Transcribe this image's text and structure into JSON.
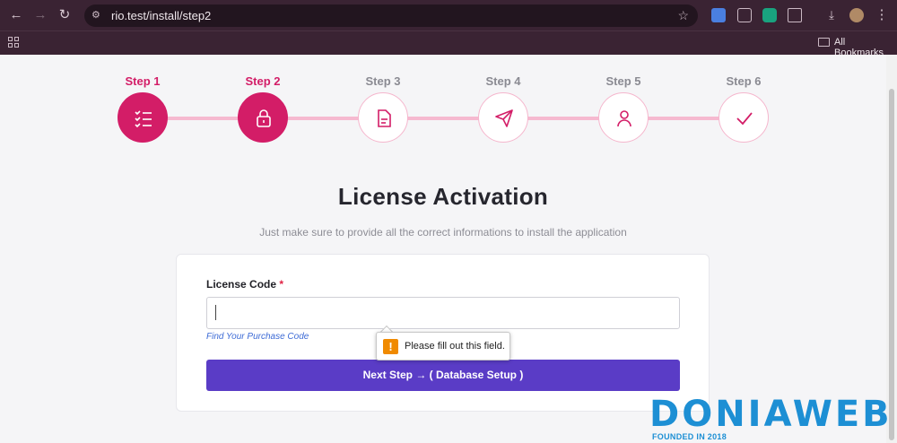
{
  "browser": {
    "url": "rio.test/install/step2",
    "bookmarks_label": "All Bookmarks",
    "icons": [
      "back-icon",
      "forward-icon",
      "reload-icon",
      "site-settings-icon",
      "bookmark-star-icon",
      "translate-icon",
      "extension-icon",
      "chatgpt-icon",
      "puzzle-icon",
      "download-icon",
      "profile-avatar",
      "menu-icon",
      "apps-icon",
      "folder-icon"
    ]
  },
  "steps": [
    {
      "label": "Step 1",
      "icon": "checklist-icon",
      "state": "completed"
    },
    {
      "label": "Step 2",
      "icon": "lock-icon",
      "state": "current"
    },
    {
      "label": "Step 3",
      "icon": "document-icon",
      "state": "pending"
    },
    {
      "label": "Step 4",
      "icon": "paper-plane-icon",
      "state": "pending"
    },
    {
      "label": "Step 5",
      "icon": "user-icon",
      "state": "pending"
    },
    {
      "label": "Step 6",
      "icon": "check-icon",
      "state": "pending"
    }
  ],
  "main": {
    "title": "License Activation",
    "subtitle": "Just make sure to provide all the correct informations to install the application"
  },
  "form": {
    "license_label": "License Code",
    "required_mark": "*",
    "license_value": "",
    "purchase_link": "Find Your Purchase Code",
    "next_button": "Next Step → ( Database Setup )"
  },
  "validation": {
    "message": "Please fill out this field."
  },
  "watermark": {
    "brand": "DONIAWEB",
    "tagline": "FOUNDED IN 2018"
  },
  "colors": {
    "accent": "#d31d67",
    "button": "#5a3cc6",
    "connector": "#f6b9d0",
    "chrome": "#3a2333",
    "watermark": "#1d8fd4"
  }
}
